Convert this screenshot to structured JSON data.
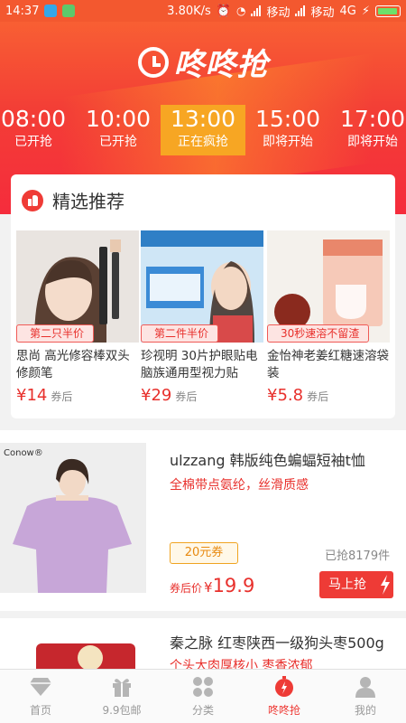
{
  "status_bar": {
    "time": "14:37",
    "speed": "3.80K/s",
    "carrier1": "移动",
    "carrier2": "移动",
    "network": "4G"
  },
  "header": {
    "logo_text": "咚咚抢",
    "time_slots": [
      {
        "time": "08:00",
        "status": "已开抢"
      },
      {
        "time": "10:00",
        "status": "已开抢"
      },
      {
        "time": "13:00",
        "status": "正在疯抢"
      },
      {
        "time": "15:00",
        "status": "即将开始"
      },
      {
        "time": "17:00",
        "status": "即将开始"
      }
    ]
  },
  "recommend": {
    "title": "精选推荐",
    "items": [
      {
        "tag": "第二只半价",
        "name": "思尚 高光修容棒双头修颜笔",
        "price": "¥14",
        "price_note": "券后"
      },
      {
        "tag": "第二件半价",
        "name": "珍视明 30片护眼贴电脑族通用型视力贴",
        "price": "¥29",
        "price_note": "券后"
      },
      {
        "tag": "30秒速溶不留渣",
        "name": "金怡神老姜红糖速溶袋装",
        "price": "¥5.8",
        "price_note": "券后"
      }
    ]
  },
  "products": [
    {
      "brand_text": "Conow®",
      "title": "ulzzang 韩版纯色蝙蝠短袖t恤",
      "subtitle": "全棉带点氨纶，丝滑质感",
      "coupon": "20元券",
      "sold": "已抢8179件",
      "after_label": "券后价",
      "currency": "¥",
      "price": "19.9",
      "buy_label": "马上抢"
    },
    {
      "title": "秦之脉 红枣陕西一级狗头枣500g",
      "subtitle": "个头大肉厚核小  枣香浓郁"
    }
  ],
  "bottom_nav": [
    {
      "label": "首页",
      "icon": "diamond-icon"
    },
    {
      "label": "9.9包邮",
      "icon": "gift-icon"
    },
    {
      "label": "分类",
      "icon": "category-icon"
    },
    {
      "label": "咚咚抢",
      "icon": "stopwatch-icon",
      "active": true
    },
    {
      "label": "我的",
      "icon": "user-icon"
    }
  ],
  "colors": {
    "accent": "#ee3b36",
    "active_slot": "#f7a623",
    "coupon": "#f0a420"
  }
}
